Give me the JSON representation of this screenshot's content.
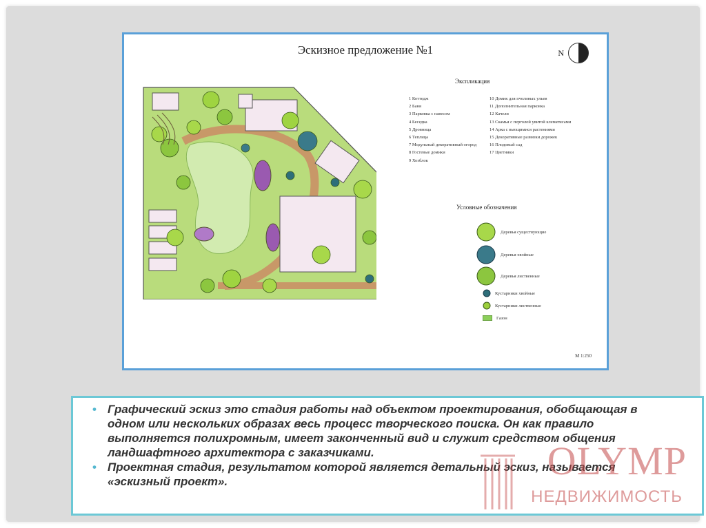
{
  "plan": {
    "title": "Эскизное предложение №1",
    "north_label": "N",
    "scale": "М 1:250",
    "explication": {
      "title": "Экспликация",
      "left_items": [
        "1  Коттедж",
        "2  Баня",
        "3  Парковка с навесом",
        "4  Беседка",
        "5  Дровница",
        "6  Теплица",
        "7  Модульный декоративный огород",
        "8  Гостевые домики",
        "9  Хозблок"
      ],
      "right_items": [
        "10 Домик для пчелиных ульев",
        "11 Дополнительная парковка",
        "12 Качели",
        "13 Скамья с перголой увитой клематисами",
        "14 Арка с вьющимися растениями",
        "15 Декоративные развязки дорожек",
        "16 Плодовый сад",
        "17 Цветники"
      ]
    },
    "legend": {
      "title": "Условные обозначения",
      "items": [
        {
          "label": "Деревья существующие",
          "icon": "existing-tree-icon",
          "color": "#a8d84a"
        },
        {
          "label": "Деревья хвойные",
          "icon": "conifer-tree-icon",
          "color": "#3a7a8a"
        },
        {
          "label": "Деревья лиственные",
          "icon": "deciduous-tree-icon",
          "color": "#8cc63f"
        },
        {
          "label": "Кустарники хвойные",
          "icon": "conifer-shrub-icon",
          "color": "#2e6e7a"
        },
        {
          "label": "Кустарники лиственные",
          "icon": "deciduous-shrub-icon",
          "color": "#9ccf3c"
        },
        {
          "label": "Газон",
          "icon": "lawn-icon",
          "color": "#8ccf5a"
        }
      ]
    }
  },
  "bullets": [
    "Графический эскиз это стадия работы над объектом проектирования, обобщающая в одном или нескольких образах весь процесс творческого поиска. Он как правило выполняется полихромным, имеет законченный вид и служит средством общения ландшафтного архитектора с заказчиками.",
    "Проектная стадия, результатом которой является детальный эскиз, называется «эскизный проект»."
  ],
  "watermark": {
    "brand": "OLYMP",
    "subtitle": "НЕДВИЖИМОСТЬ",
    "color": "#c44a4a"
  },
  "colors": {
    "frame_border": "#5aa0d8",
    "text_box_border": "#6cc8d6",
    "bullet": "#55b8d0",
    "lawn": "#c8e6a0",
    "path": "#c89868"
  }
}
